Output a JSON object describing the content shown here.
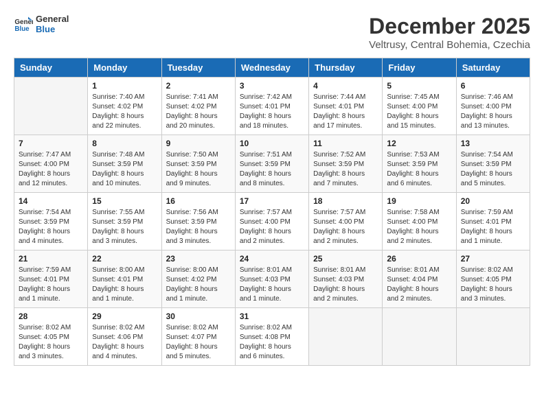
{
  "header": {
    "logo_line1": "General",
    "logo_line2": "Blue",
    "title": "December 2025",
    "subtitle": "Veltrusy, Central Bohemia, Czechia"
  },
  "days_of_week": [
    "Sunday",
    "Monday",
    "Tuesday",
    "Wednesday",
    "Thursday",
    "Friday",
    "Saturday"
  ],
  "weeks": [
    [
      {
        "day": "",
        "sunrise": "",
        "sunset": "",
        "daylight": ""
      },
      {
        "day": "1",
        "sunrise": "Sunrise: 7:40 AM",
        "sunset": "Sunset: 4:02 PM",
        "daylight": "Daylight: 8 hours and 22 minutes."
      },
      {
        "day": "2",
        "sunrise": "Sunrise: 7:41 AM",
        "sunset": "Sunset: 4:02 PM",
        "daylight": "Daylight: 8 hours and 20 minutes."
      },
      {
        "day": "3",
        "sunrise": "Sunrise: 7:42 AM",
        "sunset": "Sunset: 4:01 PM",
        "daylight": "Daylight: 8 hours and 18 minutes."
      },
      {
        "day": "4",
        "sunrise": "Sunrise: 7:44 AM",
        "sunset": "Sunset: 4:01 PM",
        "daylight": "Daylight: 8 hours and 17 minutes."
      },
      {
        "day": "5",
        "sunrise": "Sunrise: 7:45 AM",
        "sunset": "Sunset: 4:00 PM",
        "daylight": "Daylight: 8 hours and 15 minutes."
      },
      {
        "day": "6",
        "sunrise": "Sunrise: 7:46 AM",
        "sunset": "Sunset: 4:00 PM",
        "daylight": "Daylight: 8 hours and 13 minutes."
      }
    ],
    [
      {
        "day": "7",
        "sunrise": "Sunrise: 7:47 AM",
        "sunset": "Sunset: 4:00 PM",
        "daylight": "Daylight: 8 hours and 12 minutes."
      },
      {
        "day": "8",
        "sunrise": "Sunrise: 7:48 AM",
        "sunset": "Sunset: 3:59 PM",
        "daylight": "Daylight: 8 hours and 10 minutes."
      },
      {
        "day": "9",
        "sunrise": "Sunrise: 7:50 AM",
        "sunset": "Sunset: 3:59 PM",
        "daylight": "Daylight: 8 hours and 9 minutes."
      },
      {
        "day": "10",
        "sunrise": "Sunrise: 7:51 AM",
        "sunset": "Sunset: 3:59 PM",
        "daylight": "Daylight: 8 hours and 8 minutes."
      },
      {
        "day": "11",
        "sunrise": "Sunrise: 7:52 AM",
        "sunset": "Sunset: 3:59 PM",
        "daylight": "Daylight: 8 hours and 7 minutes."
      },
      {
        "day": "12",
        "sunrise": "Sunrise: 7:53 AM",
        "sunset": "Sunset: 3:59 PM",
        "daylight": "Daylight: 8 hours and 6 minutes."
      },
      {
        "day": "13",
        "sunrise": "Sunrise: 7:54 AM",
        "sunset": "Sunset: 3:59 PM",
        "daylight": "Daylight: 8 hours and 5 minutes."
      }
    ],
    [
      {
        "day": "14",
        "sunrise": "Sunrise: 7:54 AM",
        "sunset": "Sunset: 3:59 PM",
        "daylight": "Daylight: 8 hours and 4 minutes."
      },
      {
        "day": "15",
        "sunrise": "Sunrise: 7:55 AM",
        "sunset": "Sunset: 3:59 PM",
        "daylight": "Daylight: 8 hours and 3 minutes."
      },
      {
        "day": "16",
        "sunrise": "Sunrise: 7:56 AM",
        "sunset": "Sunset: 3:59 PM",
        "daylight": "Daylight: 8 hours and 3 minutes."
      },
      {
        "day": "17",
        "sunrise": "Sunrise: 7:57 AM",
        "sunset": "Sunset: 4:00 PM",
        "daylight": "Daylight: 8 hours and 2 minutes."
      },
      {
        "day": "18",
        "sunrise": "Sunrise: 7:57 AM",
        "sunset": "Sunset: 4:00 PM",
        "daylight": "Daylight: 8 hours and 2 minutes."
      },
      {
        "day": "19",
        "sunrise": "Sunrise: 7:58 AM",
        "sunset": "Sunset: 4:00 PM",
        "daylight": "Daylight: 8 hours and 2 minutes."
      },
      {
        "day": "20",
        "sunrise": "Sunrise: 7:59 AM",
        "sunset": "Sunset: 4:01 PM",
        "daylight": "Daylight: 8 hours and 1 minute."
      }
    ],
    [
      {
        "day": "21",
        "sunrise": "Sunrise: 7:59 AM",
        "sunset": "Sunset: 4:01 PM",
        "daylight": "Daylight: 8 hours and 1 minute."
      },
      {
        "day": "22",
        "sunrise": "Sunrise: 8:00 AM",
        "sunset": "Sunset: 4:01 PM",
        "daylight": "Daylight: 8 hours and 1 minute."
      },
      {
        "day": "23",
        "sunrise": "Sunrise: 8:00 AM",
        "sunset": "Sunset: 4:02 PM",
        "daylight": "Daylight: 8 hours and 1 minute."
      },
      {
        "day": "24",
        "sunrise": "Sunrise: 8:01 AM",
        "sunset": "Sunset: 4:03 PM",
        "daylight": "Daylight: 8 hours and 1 minute."
      },
      {
        "day": "25",
        "sunrise": "Sunrise: 8:01 AM",
        "sunset": "Sunset: 4:03 PM",
        "daylight": "Daylight: 8 hours and 2 minutes."
      },
      {
        "day": "26",
        "sunrise": "Sunrise: 8:01 AM",
        "sunset": "Sunset: 4:04 PM",
        "daylight": "Daylight: 8 hours and 2 minutes."
      },
      {
        "day": "27",
        "sunrise": "Sunrise: 8:02 AM",
        "sunset": "Sunset: 4:05 PM",
        "daylight": "Daylight: 8 hours and 3 minutes."
      }
    ],
    [
      {
        "day": "28",
        "sunrise": "Sunrise: 8:02 AM",
        "sunset": "Sunset: 4:05 PM",
        "daylight": "Daylight: 8 hours and 3 minutes."
      },
      {
        "day": "29",
        "sunrise": "Sunrise: 8:02 AM",
        "sunset": "Sunset: 4:06 PM",
        "daylight": "Daylight: 8 hours and 4 minutes."
      },
      {
        "day": "30",
        "sunrise": "Sunrise: 8:02 AM",
        "sunset": "Sunset: 4:07 PM",
        "daylight": "Daylight: 8 hours and 5 minutes."
      },
      {
        "day": "31",
        "sunrise": "Sunrise: 8:02 AM",
        "sunset": "Sunset: 4:08 PM",
        "daylight": "Daylight: 8 hours and 6 minutes."
      },
      {
        "day": "",
        "sunrise": "",
        "sunset": "",
        "daylight": ""
      },
      {
        "day": "",
        "sunrise": "",
        "sunset": "",
        "daylight": ""
      },
      {
        "day": "",
        "sunrise": "",
        "sunset": "",
        "daylight": ""
      }
    ]
  ]
}
